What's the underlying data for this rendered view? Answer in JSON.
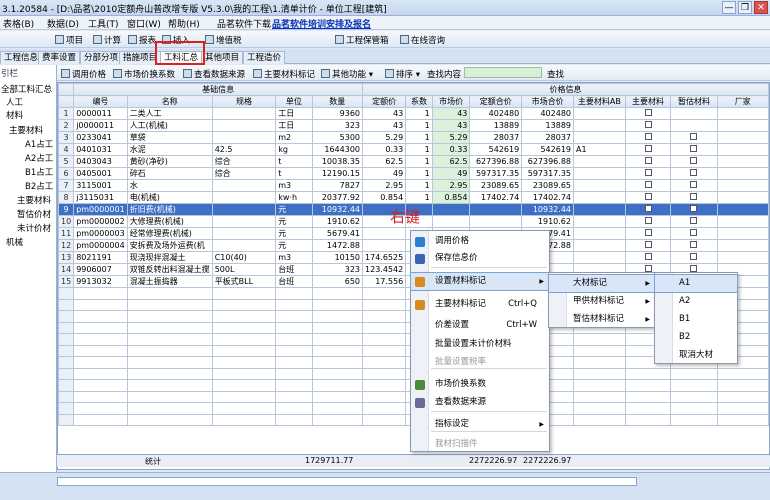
{
  "window": {
    "title": "3.1.20584 - [D:\\品茗\\2010定额舟山普改增专版 V5.3.0\\我的工程\\1.清单计价 - 单位工程[建筑]",
    "btn_min": "—",
    "btn_max": "❐",
    "btn_close": "✕"
  },
  "menubar": {
    "items": [
      "表格(B)",
      "数据(D)",
      "工具(T)",
      "窗口(W)",
      "帮助(H)",
      "品茗软件下载"
    ],
    "promo": "品茗软件培训安排及报名"
  },
  "toolbar": {
    "items": [
      "项目",
      "计算",
      "报表",
      "插入",
      "增值税",
      "工程保管箱",
      "在线咨询"
    ]
  },
  "tabs": [
    "工程信息",
    "费率设置",
    "分部分项",
    "措施项目",
    "工料汇总",
    "其他项目",
    "工程造价"
  ],
  "active_tab": "工料汇总",
  "left_tree": {
    "items": [
      "全部工料汇总",
      "人工",
      "材料",
      "主要材料",
      "A1占工",
      "A2占工",
      "B1占工",
      "B2占工",
      "主要材料",
      "暂估价材",
      "未计价材",
      "机械"
    ],
    "header": "引栏"
  },
  "subtoolbar": {
    "items": [
      "调用价格",
      "市场价换系数",
      "查看数据来源",
      "主要材料标记",
      "其他功能",
      "排序",
      "查找内容"
    ],
    "search_label": "查找"
  },
  "grid": {
    "group_basic": "基础信息",
    "group_price": "价格信息",
    "columns": [
      "编号",
      "名称",
      "规格",
      "单位",
      "数量",
      "定额价",
      "系数",
      "市场价",
      "定额合价",
      "市场合价",
      "主要材料AB",
      "主要材料",
      "暂估材料",
      "厂家"
    ],
    "rows": [
      {
        "n": "1",
        "code": "0000011",
        "name": "二类人工",
        "spec": "",
        "unit": "工日",
        "qty": "9360",
        "dprice": "43",
        "coef": "1",
        "mprice": "43",
        "dtotal": "402480",
        "mtotal": "402480",
        "ab": "",
        "main": true,
        "est": false
      },
      {
        "n": "2",
        "code": "j0000011",
        "name": "人工(机械)",
        "spec": "",
        "unit": "工日",
        "qty": "323",
        "dprice": "43",
        "coef": "1",
        "mprice": "43",
        "dtotal": "13889",
        "mtotal": "13889",
        "ab": "",
        "main": true,
        "est": false
      },
      {
        "n": "3",
        "code": "0233041",
        "name": "草袋",
        "spec": "",
        "unit": "m2",
        "qty": "5300",
        "dprice": "5.29",
        "coef": "1",
        "mprice": "5.29",
        "dtotal": "28037",
        "mtotal": "28037",
        "ab": "",
        "main": true,
        "est": true
      },
      {
        "n": "4",
        "code": "0401031",
        "name": "水泥",
        "spec": "42.5",
        "unit": "kg",
        "qty": "1644300",
        "dprice": "0.33",
        "coef": "1",
        "mprice": "0.33",
        "dtotal": "542619",
        "mtotal": "542619",
        "ab": "A1",
        "main": true,
        "est": true
      },
      {
        "n": "5",
        "code": "0403043",
        "name": "黄砂(净砂)",
        "spec": "综合",
        "unit": "t",
        "qty": "10038.35",
        "dprice": "62.5",
        "coef": "1",
        "mprice": "62.5",
        "dtotal": "627396.88",
        "mtotal": "627396.88",
        "ab": "",
        "main": true,
        "est": true
      },
      {
        "n": "6",
        "code": "0405001",
        "name": "碎石",
        "spec": "综合",
        "unit": "t",
        "qty": "12190.15",
        "dprice": "49",
        "coef": "1",
        "mprice": "49",
        "dtotal": "597317.35",
        "mtotal": "597317.35",
        "ab": "",
        "main": true,
        "est": true
      },
      {
        "n": "7",
        "code": "3115001",
        "name": "水",
        "spec": "",
        "unit": "m3",
        "qty": "7827",
        "dprice": "2.95",
        "coef": "1",
        "mprice": "2.95",
        "dtotal": "23089.65",
        "mtotal": "23089.65",
        "ab": "",
        "main": true,
        "est": true
      },
      {
        "n": "8",
        "code": "j3115031",
        "name": "电(机械)",
        "spec": "",
        "unit": "kw·h",
        "qty": "20377.92",
        "dprice": "0.854",
        "coef": "1",
        "mprice": "0.854",
        "dtotal": "17402.74",
        "mtotal": "17402.74",
        "ab": "",
        "main": true,
        "est": true
      },
      {
        "n": "9",
        "code": "pm0000001",
        "name": "折旧费(机械)",
        "spec": "",
        "unit": "元",
        "qty": "10932.44",
        "dprice": "",
        "coef": "",
        "mprice": "",
        "dtotal": "",
        "mtotal": "10932.44",
        "ab": "",
        "main": true,
        "est": true
      },
      {
        "n": "10",
        "code": "pm0000002",
        "name": "大修理费(机械)",
        "spec": "",
        "unit": "元",
        "qty": "1910.62",
        "dprice": "",
        "coef": "",
        "mprice": "",
        "dtotal": "",
        "mtotal": "1910.62",
        "ab": "",
        "main": true,
        "est": true
      },
      {
        "n": "11",
        "code": "pm0000003",
        "name": "经常修理费(机械)",
        "spec": "",
        "unit": "元",
        "qty": "5679.41",
        "dprice": "",
        "coef": "",
        "mprice": "",
        "dtotal": "",
        "mtotal": "5679.41",
        "ab": "",
        "main": true,
        "est": true
      },
      {
        "n": "12",
        "code": "pm0000004",
        "name": "安拆费及场外运费(机",
        "spec": "",
        "unit": "元",
        "qty": "1472.88",
        "dprice": "",
        "coef": "",
        "mprice": "",
        "dtotal": "",
        "mtotal": "1472.88",
        "ab": "",
        "main": true,
        "est": true
      },
      {
        "n": "13",
        "code": "8021191",
        "name": "现浇现拌混凝土",
        "spec": "C10(40)",
        "unit": "m3",
        "qty": "10150",
        "dprice": "174.6525",
        "coef": "",
        "mprice": "",
        "dtotal": "",
        "mtotal": "",
        "ab": "",
        "main": true,
        "est": true
      },
      {
        "n": "14",
        "code": "9906007",
        "name": "双锥反转出料混凝土搅",
        "spec": "500L",
        "unit": "台班",
        "qty": "323",
        "dprice": "123.4542",
        "coef": "",
        "mprice": "",
        "dtotal": "",
        "mtotal": "",
        "ab": "",
        "main": true,
        "est": true
      },
      {
        "n": "15",
        "code": "9913032",
        "name": "混凝土振捣器",
        "spec": "平板式BLL",
        "unit": "台班",
        "qty": "650",
        "dprice": "17.556",
        "coef": "",
        "mprice": "",
        "dtotal": "",
        "mtotal": "",
        "ab": "",
        "main": true,
        "est": true
      }
    ],
    "selected_row": "9",
    "total_label": "统计",
    "total_qty": "1729711.77",
    "total_dtotal": "2272226.97",
    "total_mtotal": "2272226.97"
  },
  "annotation": "右键",
  "context_menu": {
    "items": [
      {
        "label": "调用价格",
        "shortcut": "",
        "icon": "refresh-icon",
        "color": "#2f7fd0"
      },
      {
        "label": "保存信息价",
        "shortcut": "",
        "icon": "save-icon",
        "color": "#3b63b3"
      },
      {
        "label": "设置材料标记",
        "shortcut": "",
        "icon": "tag-icon",
        "color": "#d58b1e",
        "sub": true
      },
      {
        "label": "主要材料标记",
        "shortcut": "Ctrl+Q",
        "icon": "flag-icon",
        "color": "#d58b1e"
      },
      {
        "label": "价差设置",
        "shortcut": "Ctrl+W",
        "icon": "",
        "color": ""
      },
      {
        "label": "批量设置未计价材料",
        "shortcut": "",
        "icon": "",
        "color": ""
      },
      {
        "label": "批量设置税率",
        "shortcut": "",
        "icon": "",
        "color": ""
      },
      {
        "label": "市场价换系数",
        "shortcut": "",
        "icon": "table-icon",
        "color": "#4a8a3a"
      },
      {
        "label": "查看数据来源",
        "shortcut": "",
        "icon": "search-doc-icon",
        "color": "#6a6a9a"
      },
      {
        "label": "指标设定",
        "shortcut": "",
        "icon": "",
        "color": "",
        "sub": true
      },
      {
        "label": "我材扫描件",
        "shortcut": "",
        "icon": "",
        "color": ""
      }
    ]
  },
  "submenu1": {
    "items": [
      "大材标记",
      "甲供材料标记",
      "暂估材料标记"
    ]
  },
  "submenu2": {
    "items": [
      "A1",
      "A2",
      "B1",
      "B2",
      "取消大材"
    ]
  }
}
